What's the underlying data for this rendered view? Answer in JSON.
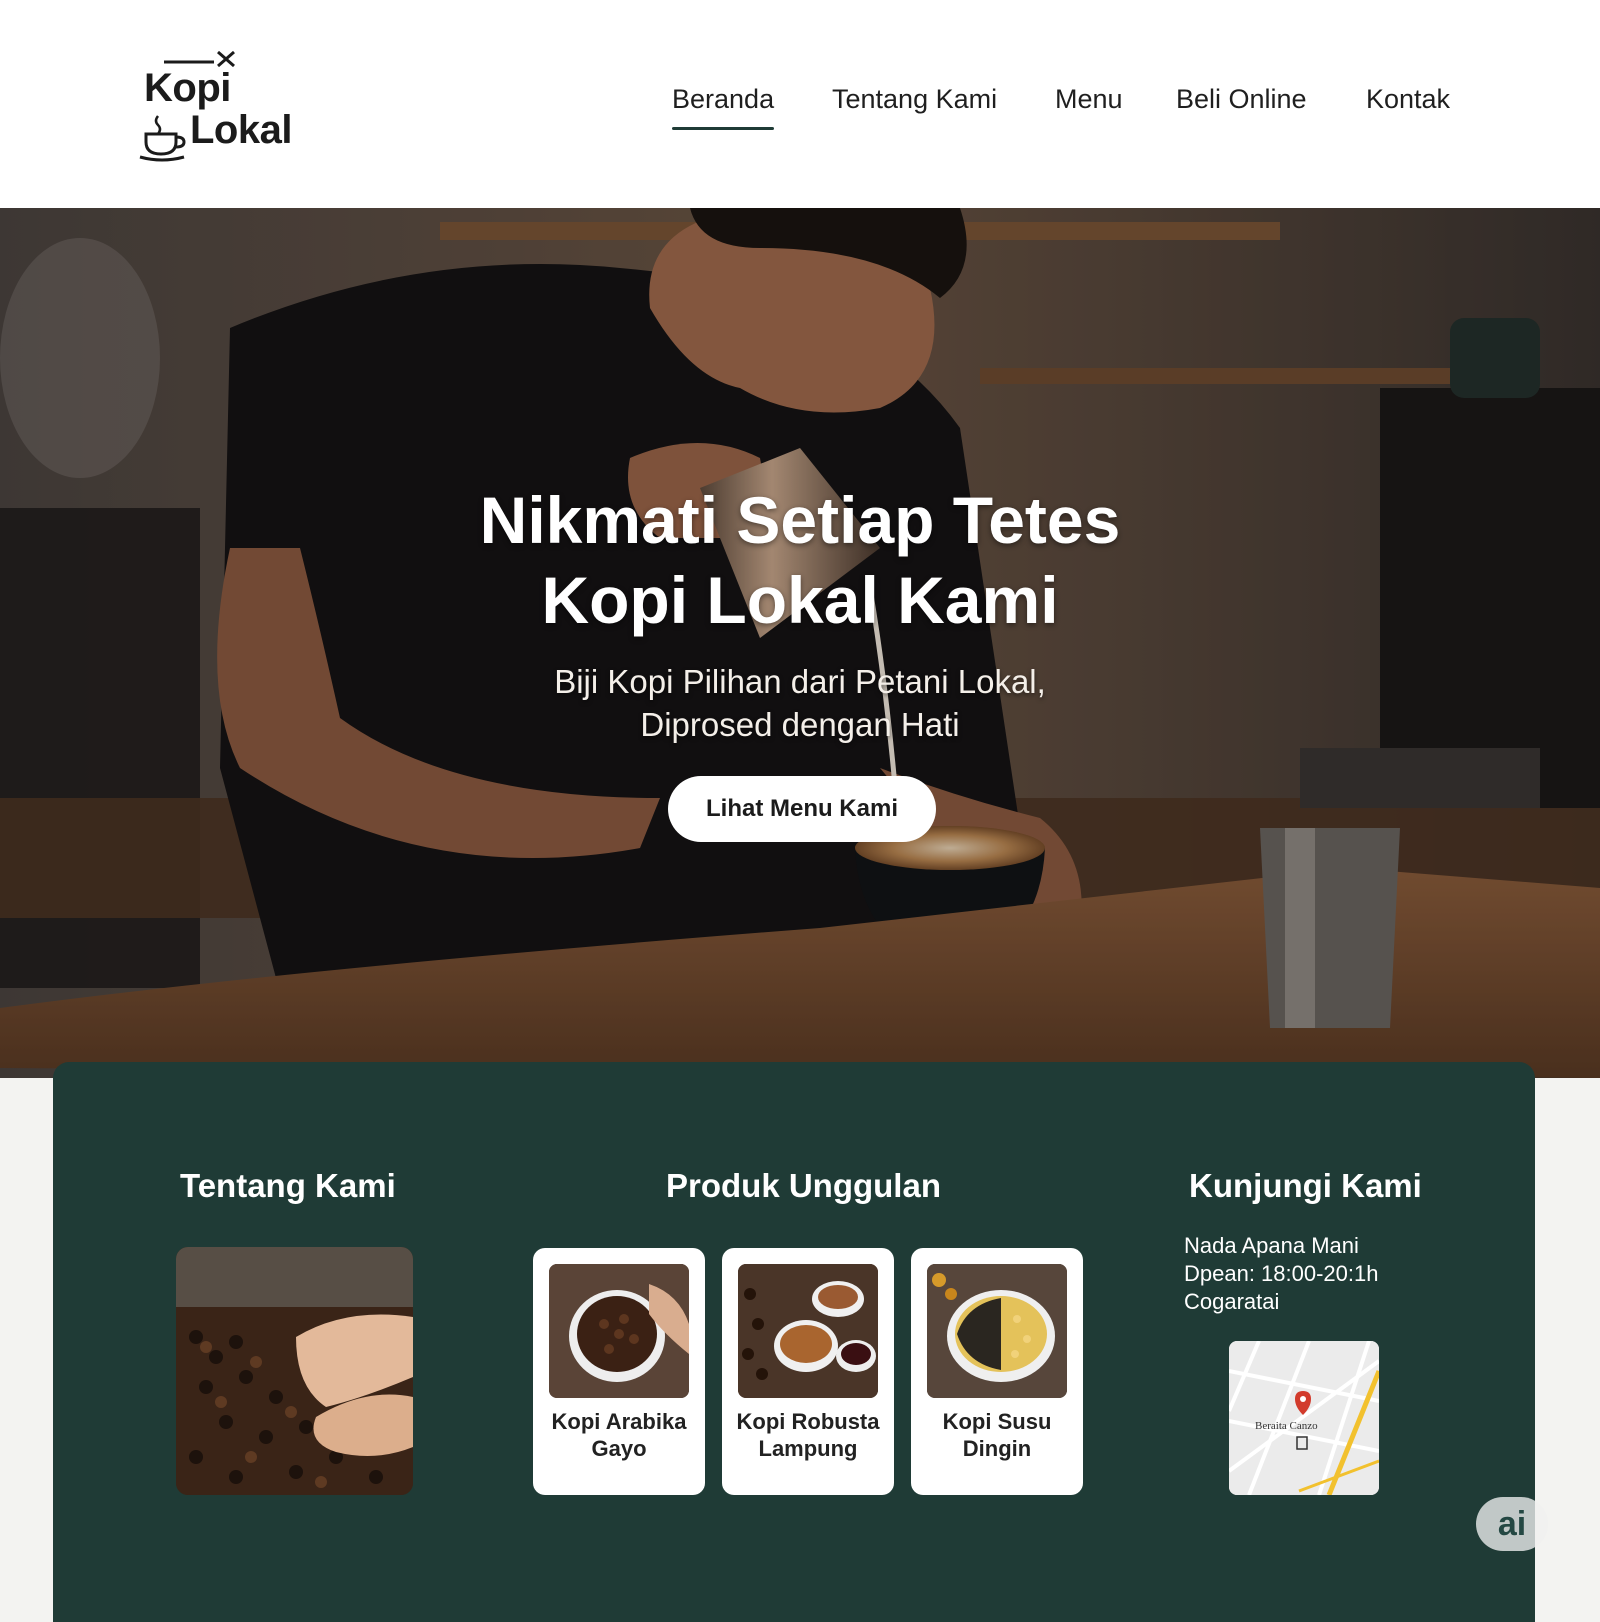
{
  "brand": {
    "line1": "Kopi",
    "line2": "Lokal",
    "icons": [
      "plane-line-icon",
      "coffee-cup-icon"
    ]
  },
  "nav": {
    "items": [
      {
        "label": "Beranda",
        "active": true
      },
      {
        "label": "Tentang Kami",
        "active": false
      },
      {
        "label": "Menu",
        "active": false
      },
      {
        "label": "Beli Online",
        "active": false
      },
      {
        "label": "Kontak",
        "active": false
      }
    ]
  },
  "hero": {
    "title_line1": "Nikmati Setiap Tetes",
    "title_line2": "Kopi Lokal Kami",
    "subtitle_line1": "Biji Kopi Pilihan dari Petani Lokal,",
    "subtitle_line2": "Diprosed dengan Hati",
    "cta_label": "Lihat Menu Kami"
  },
  "sections": {
    "about": {
      "title": "Tentang Kami"
    },
    "products": {
      "title": "Produk Unggulan",
      "items": [
        {
          "name_line1": "Kopi Arabika",
          "name_line2": "Gayo"
        },
        {
          "name_line1": "Kopi Robusta",
          "name_line2": "Lampung"
        },
        {
          "name_line1": "Kopi Susu Dingin",
          "name_line2": ""
        }
      ]
    },
    "visit": {
      "title": "Kunjungi Kami",
      "lines": [
        "Nada Apana Mani",
        "Dpean: 18:00-20:1h",
        "Cogaratai"
      ],
      "map_label": "Beraita Canzo"
    }
  },
  "badge": {
    "label": "ai"
  },
  "colors": {
    "panel": "#1f3b36",
    "header_bg": "#ffffff",
    "page_bg": "#f3f3f1",
    "map_road": "#f2c12e",
    "map_pin": "#d23b2c"
  }
}
